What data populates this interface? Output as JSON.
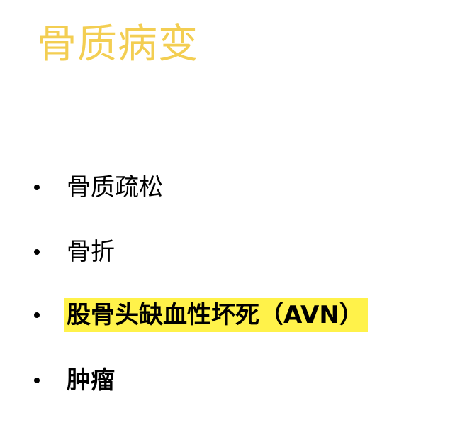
{
  "slide": {
    "title": "骨质病变",
    "title_color": "#F3CE52",
    "highlight_color": "#FFF24A",
    "items": [
      {
        "text": "骨质疏松",
        "bold": false,
        "highlighted": false
      },
      {
        "text": "骨折",
        "bold": false,
        "highlighted": false
      },
      {
        "text": "股骨头缺血性坏死（AVN）",
        "bold": true,
        "highlighted": true
      },
      {
        "text": "肿瘤",
        "bold": true,
        "highlighted": false
      }
    ]
  }
}
